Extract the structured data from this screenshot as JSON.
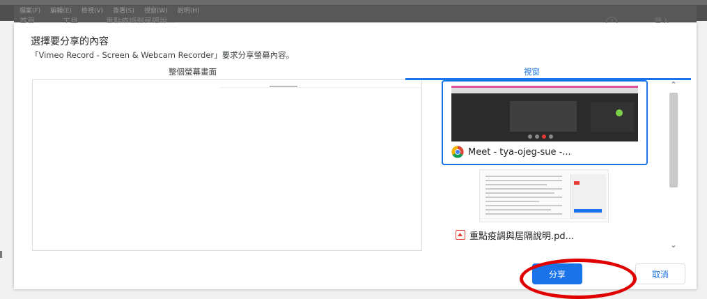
{
  "background": {
    "menu_items": [
      "檔案(F)",
      "編輯(E)",
      "檢視(V)",
      "簽署(S)",
      "視窗(W)",
      "說明(H)"
    ],
    "row2_items": [
      "首頁",
      "工具",
      "重點疫調與居隔說..."
    ],
    "right_label": "登入",
    "help_glyph": "?"
  },
  "dialog": {
    "title": "選擇要分享的內容",
    "subtitle": "「Vimeo Record - Screen & Webcam Recorder」要求分享螢幕內容。",
    "tabs": [
      {
        "label": "整個螢幕畫面",
        "selected": false
      },
      {
        "label": "視窗",
        "selected": true
      }
    ],
    "windows": [
      {
        "label": "Meet - tya-ojeg-sue -...",
        "icon": "chrome-icon",
        "selected": true
      },
      {
        "label": "重點疫調與居隔說明.pd...",
        "icon": "pdf-icon",
        "selected": false
      }
    ],
    "scroll_up_glyph": "⌃",
    "scroll_down_glyph": "⌄",
    "share_label": "分享",
    "cancel_label": "取消"
  },
  "colors": {
    "accent": "#1a73e8",
    "annotation_ring": "#e00000"
  }
}
